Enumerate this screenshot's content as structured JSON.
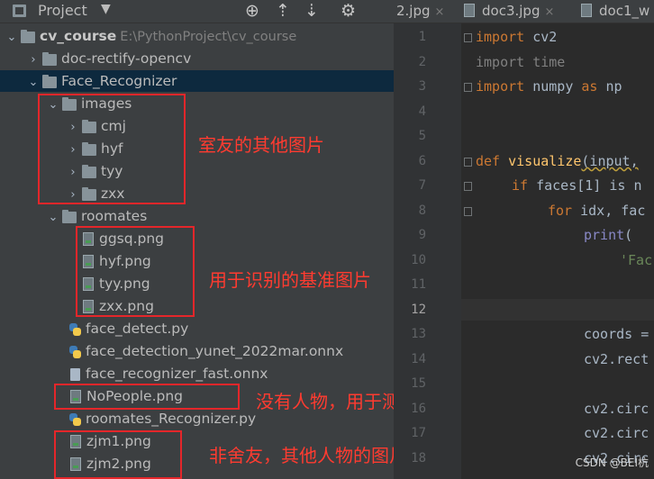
{
  "project_panel": {
    "title": "Project",
    "caret": "▼",
    "tools": {
      "locate": "⊕",
      "expand": "⇡",
      "collapse": "⇣",
      "settings": "⚙"
    }
  },
  "tree": {
    "root_name": "cv_course",
    "root_path": "E:\\PythonProject\\cv_course",
    "doc_rectify": "doc-rectify-opencv",
    "face_recognizer": "Face_Recognizer",
    "images": "images",
    "images_children": [
      "cmj",
      "hyf",
      "tyy",
      "zxx"
    ],
    "roomates": "roomates",
    "roomates_children": [
      "ggsq.png",
      "hyf.png",
      "tyy.png",
      "zxx.png"
    ],
    "face_detect": "face_detect.py",
    "yunet": "face_detection_yunet_2022mar.onnx",
    "recognizer_fast": "face_recognizer_fast.onnx",
    "nopeople": "NoPeople.png",
    "roomates_recognizer": "roomates_Recognizer.py",
    "zjm1": "zjm1.png",
    "zjm2": "zjm2.png"
  },
  "annotations": {
    "images": "室友的其他图片",
    "roomates": "用于识别的基准图片",
    "nopeople": "没有人物，用于测试的图片",
    "zjm": "非舍友，其他人物的图片"
  },
  "tabs": [
    "2.jpg",
    "doc3.jpg",
    "doc1_w"
  ],
  "tab_close": "×",
  "line_numbers": [
    "1",
    "2",
    "3",
    "4",
    "5",
    "6",
    "7",
    "8",
    "9",
    "10",
    "11",
    "12",
    "13",
    "14",
    "15",
    "16",
    "17",
    "18"
  ],
  "code": {
    "l1_kw": "import",
    "l1_rest": " cv2",
    "l2_kw": "import",
    "l2_rest": " time",
    "l3_kw": "import",
    "l3_rest": " numpy ",
    "l3_as": "as",
    "l3_np": " np",
    "l6_kw": "def",
    "l6_fn": " visualize",
    "l6_rest": "(input,",
    "l7_kw": "if",
    "l7_rest": " faces[1] is n",
    "l8_kw": "for",
    "l8_rest": " idx, fac",
    "l9_bi": "print",
    "l9_rest": "(",
    "l10_str": "'Fac",
    "l13_rest": "coords =",
    "l14_rest": "cv2.rect",
    "l16_rest": "cv2.circ",
    "l17_rest": "cv2.circ",
    "l18_rest": "cv2.circ"
  },
  "watermark": "CSDN @BEI杭"
}
